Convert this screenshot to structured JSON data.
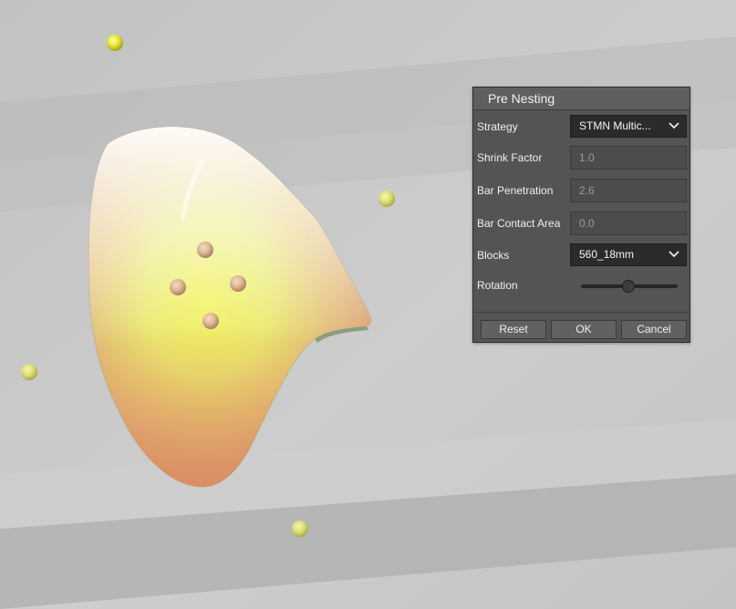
{
  "dialog": {
    "title": "Pre Nesting",
    "strategy": {
      "label": "Strategy",
      "value": "STMN Multic..."
    },
    "shrink_factor": {
      "label": "Shrink Factor",
      "value": "1.0"
    },
    "bar_penetration": {
      "label": "Bar Penetration",
      "value": "2.6"
    },
    "bar_contact_area": {
      "label": "Bar Contact Area",
      "value": "0.0"
    },
    "blocks": {
      "label": "Blocks",
      "value": "560_18mm"
    },
    "rotation": {
      "label": "Rotation",
      "level": 0.49
    },
    "buttons": {
      "reset": "Reset",
      "ok": "OK",
      "cancel": "Cancel"
    }
  },
  "colors": {
    "background": "#c8c8c8",
    "panel": "#545454",
    "field_dark": "#2b2b2b",
    "marker_yellow": "#e6e635",
    "marker_peach": "#e2b994"
  }
}
